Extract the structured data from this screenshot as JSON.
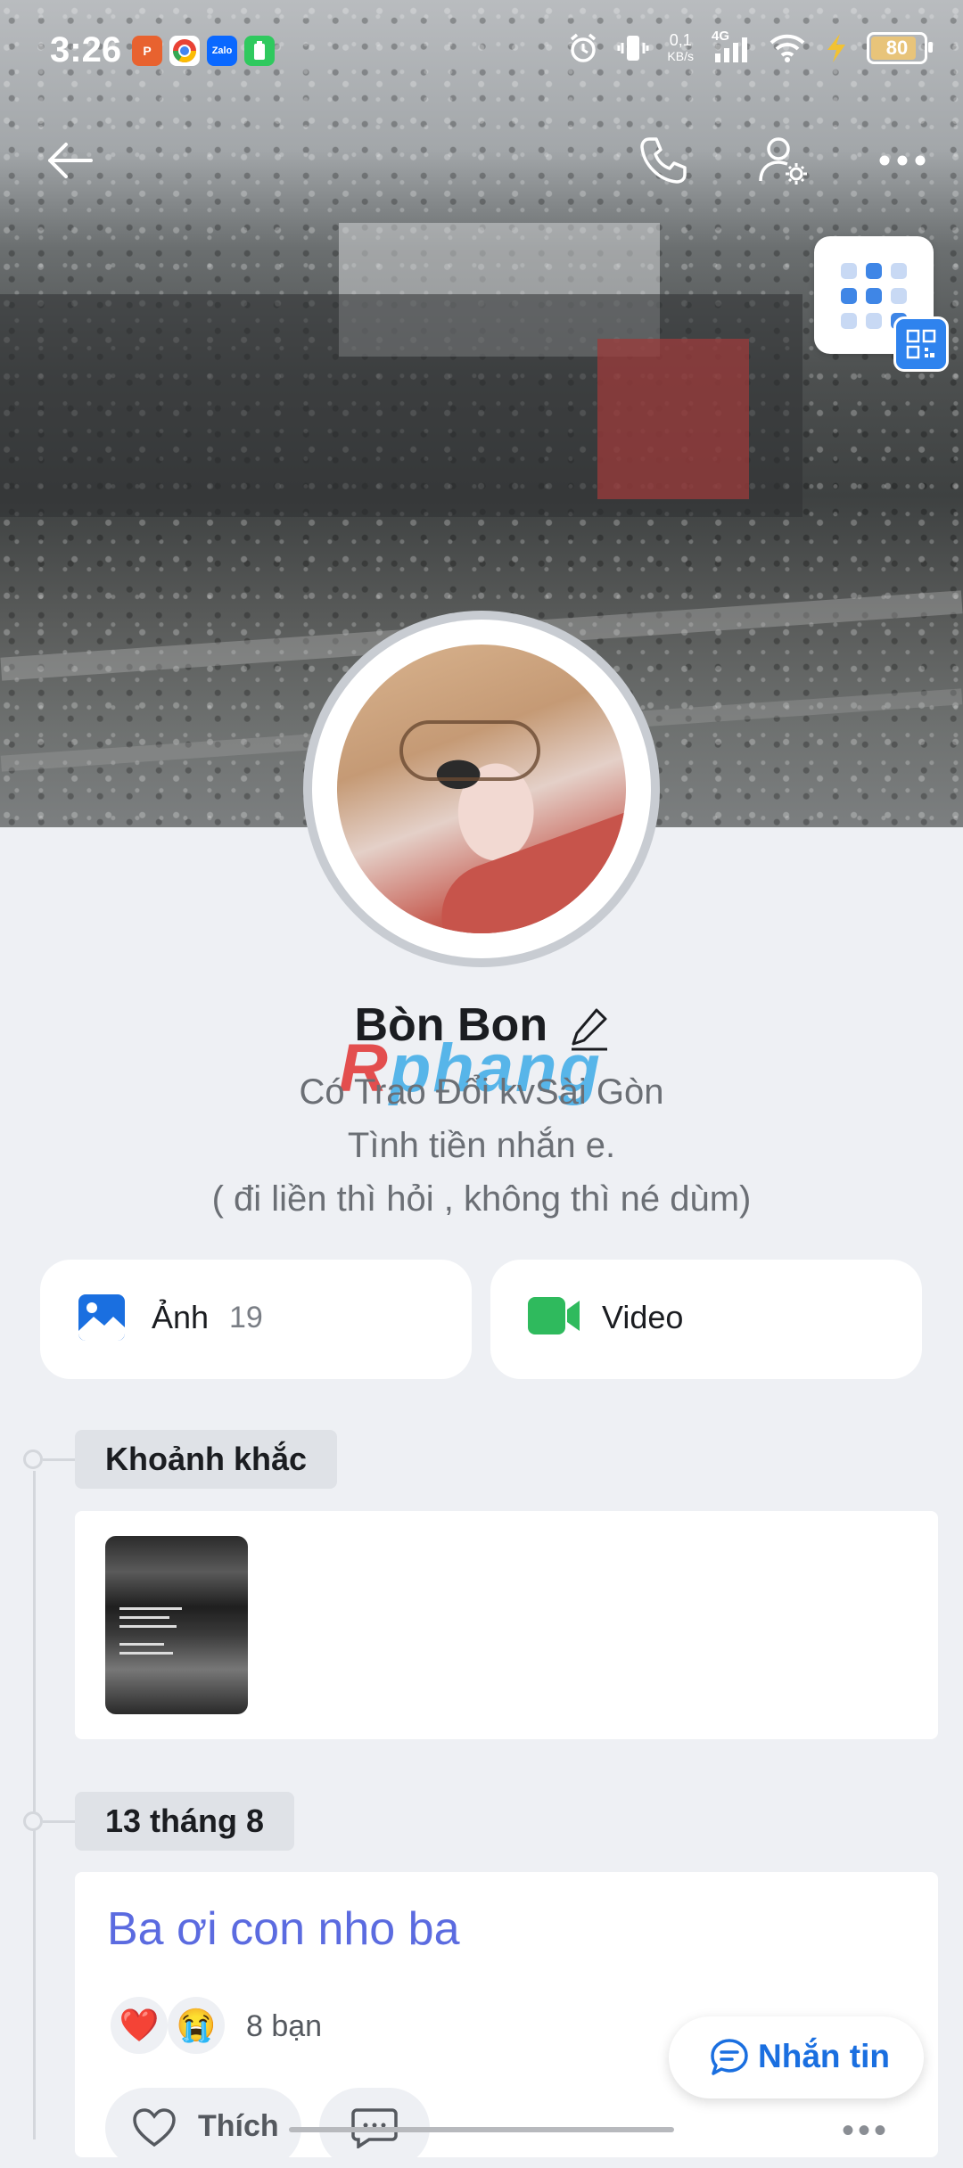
{
  "status_bar": {
    "time": "3:26",
    "net_speed_value": "0,1",
    "net_speed_unit": "KB/s",
    "network_type": "4G",
    "battery": "80",
    "app_icons": [
      "pinterest-like-icon",
      "chrome-icon",
      "zalo-icon",
      "battery-saver-icon"
    ],
    "zalo_label": "Zalo"
  },
  "profile": {
    "name": "Bòn Bon",
    "bio_lines": [
      "Có Trao Đổi kvSài Gòn",
      "Tình tiền nhắn e.",
      "( đi liền thì hỏi , không thì né dùm)"
    ],
    "watermark": "Rphang"
  },
  "media": {
    "photos_label": "Ảnh",
    "photos_count": "19",
    "video_label": "Video"
  },
  "timeline": {
    "moments_label": "Khoảnh khắc",
    "date_label": "13 tháng 8",
    "post": {
      "text": "Ba ơi con nho ba",
      "reactions": [
        "❤️",
        "😭"
      ],
      "reaction_count": "8 bạn",
      "like_label": "Thích"
    }
  },
  "message_button": {
    "label": "Nhắn tin"
  },
  "colors": {
    "accent": "#1a6fe0",
    "post_text": "#5b6be0",
    "background": "#eef0f4",
    "video_green": "#2fba5d"
  }
}
